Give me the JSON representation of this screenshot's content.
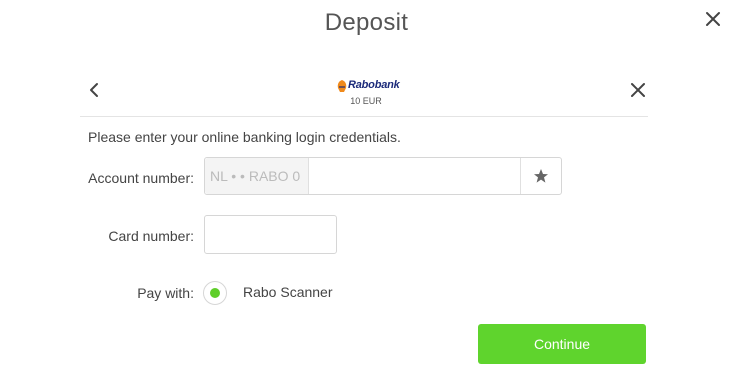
{
  "modal": {
    "title": "Deposit"
  },
  "bank": {
    "name": "Rabobank",
    "amount": "10 EUR"
  },
  "form": {
    "instructions": "Please enter your online banking login credentials.",
    "account_label": "Account number:",
    "account_prefix": "NL • • RABO 0",
    "account_value": "",
    "card_label": "Card number:",
    "card_value": "",
    "pay_label": "Pay with:",
    "pay_option": "Rabo Scanner"
  },
  "actions": {
    "continue_label": "Continue"
  },
  "colors": {
    "accent": "#5fd42d",
    "bank_blue": "#1b2a7a",
    "bank_orange": "#f08a1c"
  }
}
